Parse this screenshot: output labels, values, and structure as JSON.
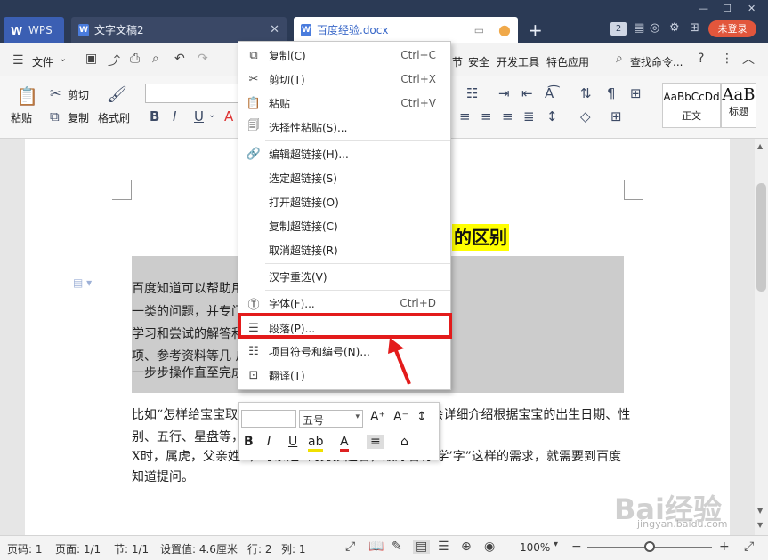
{
  "titlebar": {
    "wps_tab": "WPS",
    "tab_doc2": "文字文稿2",
    "tab_active": "百度经验.docx",
    "tab_count": "2",
    "login": "未登录"
  },
  "menubar": {
    "file": "文件",
    "tail_items": [
      "节",
      "安全",
      "开发工具",
      "特色应用"
    ],
    "search": "查找命令..."
  },
  "ribbon": {
    "paste": "粘贴",
    "cut": "剪切",
    "copy": "复制",
    "format_painter": "格式刷",
    "styles": [
      {
        "sample": "AaBbCcDd",
        "name": "正文"
      },
      {
        "sample": "AaB",
        "name": "标题"
      }
    ]
  },
  "document": {
    "title": "的区别",
    "selected_lines": [
      "百度知道可以帮助用户                                         中解决用户“怎样做”“怎么办”这",
      "一类的问题，并专门                                         性的特点，提供更便于用户阅读、",
      "学习和尝试的解答和                                         工具/原料、步骤/方法、注意事",
      "项、参考资料等几                                          户可以按照文字和图片的指导，",
      "一步步操作直至完成                                        定制化、结果化的问题。"
    ],
    "plain_lines": [
      "比如“怎样给宝宝取名”可以在百度经验找到答案，经验会详细介绍根据宝宝的出生日期、性",
      "别、五行、星盘等，                                   字，但像“给出生在 X 年 X 月 X 日",
      "X时，属虎，父亲姓X，母亲姓X的男孩起名，最好名有‘学’字”这样的需求，就需要到百度",
      "知道提问。"
    ]
  },
  "context_menu": {
    "items": [
      {
        "icon": "copy-icon",
        "label": "复制(C)",
        "shortcut": "Ctrl+C"
      },
      {
        "icon": "scissors-icon",
        "label": "剪切(T)",
        "shortcut": "Ctrl+X"
      },
      {
        "icon": "paste-icon",
        "label": "粘贴",
        "shortcut": "Ctrl+V"
      },
      {
        "icon": "paste-special-icon",
        "label": "选择性粘贴(S)...",
        "shortcut": ""
      },
      {
        "icon": "link-icon",
        "label": "编辑超链接(H)...",
        "shortcut": ""
      },
      {
        "icon": "",
        "label": "选定超链接(S)",
        "shortcut": ""
      },
      {
        "icon": "",
        "label": "打开超链接(O)",
        "shortcut": ""
      },
      {
        "icon": "",
        "label": "复制超链接(C)",
        "shortcut": ""
      },
      {
        "icon": "",
        "label": "取消超链接(R)",
        "shortcut": ""
      },
      {
        "icon": "",
        "label": "汉字重选(V)",
        "shortcut": ""
      },
      {
        "icon": "font-icon",
        "label": "字体(F)...",
        "shortcut": "Ctrl+D"
      },
      {
        "icon": "paragraph-icon",
        "label": "段落(P)...",
        "shortcut": ""
      },
      {
        "icon": "list-icon",
        "label": "项目符号和编号(N)...",
        "shortcut": ""
      },
      {
        "icon": "translate-icon",
        "label": "翻译(T)",
        "shortcut": ""
      }
    ]
  },
  "mini_toolbar": {
    "font_size": "五号"
  },
  "statusbar": {
    "page_num": "页码: 1",
    "page_count": "页面: 1/1",
    "section": "节: 1/1",
    "setting": "设置值: 4.6厘米",
    "row": "行: 2",
    "col": "列: 1",
    "zoom": "100%"
  },
  "watermark": {
    "brand": "Bai经验",
    "url": "jingyan.baidu.com"
  },
  "colors": {
    "titlebar": "#2b3a55",
    "accent": "#3867c8",
    "highlight_border": "#e31b1b",
    "selection": "#cccccc",
    "title_highlight": "#ffff00",
    "login": "#e2563c"
  }
}
